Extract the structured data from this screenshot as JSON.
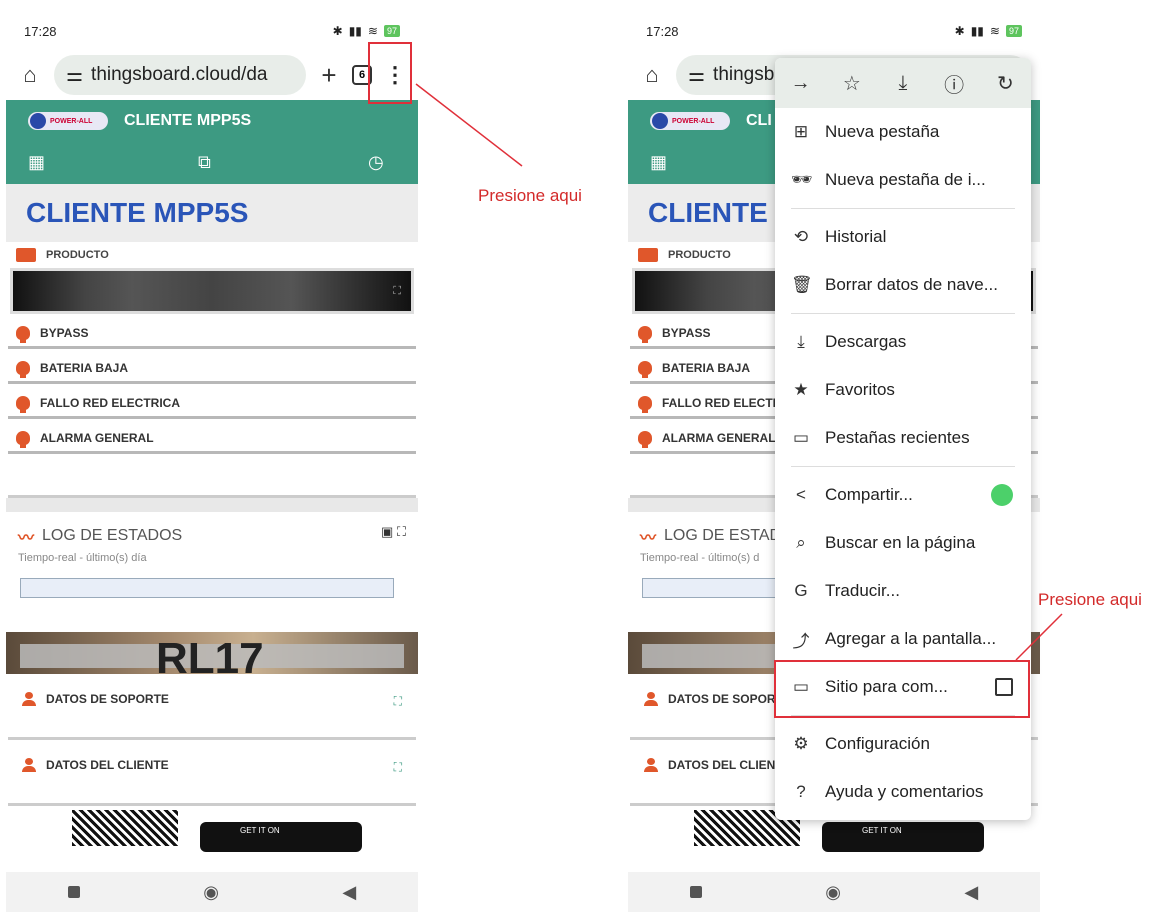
{
  "status": {
    "time": "17:28",
    "extra": "♂ ···",
    "battery": "97"
  },
  "browser": {
    "url": "thingsboard.cloud/da",
    "url_short": "thingsb",
    "tabs": "6"
  },
  "dashboard": {
    "client_title": "CLIENTE MPP5S",
    "client_title_short": "CLI",
    "heading": "CLIENTE MPP5S",
    "heading_short": "CLIENTE",
    "product_label": "PRODUCTO",
    "alarms": [
      "BYPASS",
      "BATERIA BAJA",
      "FALLO RED ELECTRICA",
      "ALARMA GENERAL"
    ],
    "alarms_short": [
      "BYPASS",
      "BATERIA BAJA",
      "FALLO RED ELECTRI",
      "ALARMA GENERAL"
    ],
    "log_title": "LOG DE ESTADOS",
    "log_title_short": "LOG DE ESTAD",
    "log_subtitle": "Tiempo-real - último(s) día",
    "log_subtitle_short": "Tiempo-real - último(s) d",
    "banner_text": "RL17",
    "support": "DATOS DE SOPORTE",
    "support_short": "DATOS DE SOPORT",
    "client_data": "DATOS DEL CLIENTE",
    "client_data_short": "DATOS DEL CLIENT",
    "store_label": "GET IT ON"
  },
  "menu": {
    "top_icons": [
      "→",
      "☆",
      "⤓",
      "ⓘ",
      "↻"
    ],
    "items": [
      {
        "icon": "⊞",
        "label": "Nueva pestaña"
      },
      {
        "icon": "🕶",
        "label": "Nueva pestaña de i..."
      },
      {
        "icon": "⟲",
        "label": "Historial"
      },
      {
        "icon": "🗑",
        "label": "Borrar datos de nave..."
      },
      {
        "icon": "⤓",
        "label": "Descargas"
      },
      {
        "icon": "★",
        "label": "Favoritos"
      },
      {
        "icon": "▭",
        "label": "Pestañas recientes"
      },
      {
        "icon": "<",
        "label": "Compartir..."
      },
      {
        "icon": "⌕",
        "label": "Buscar en la página"
      },
      {
        "icon": "G",
        "label": "Traducir..."
      },
      {
        "icon": "⤴",
        "label": "Agregar a la pantalla..."
      },
      {
        "icon": "▭",
        "label": "Sitio para com..."
      },
      {
        "icon": "⚙",
        "label": "Configuración"
      },
      {
        "icon": "?",
        "label": "Ayuda y comentarios"
      }
    ]
  },
  "annotations": {
    "left": "Presione aqui",
    "right": "Presione aqui"
  },
  "colors": {
    "accent": "#3d9a82",
    "heading": "#2a55b8",
    "alarm": "#e0572b",
    "annotation": "#e0303a"
  }
}
